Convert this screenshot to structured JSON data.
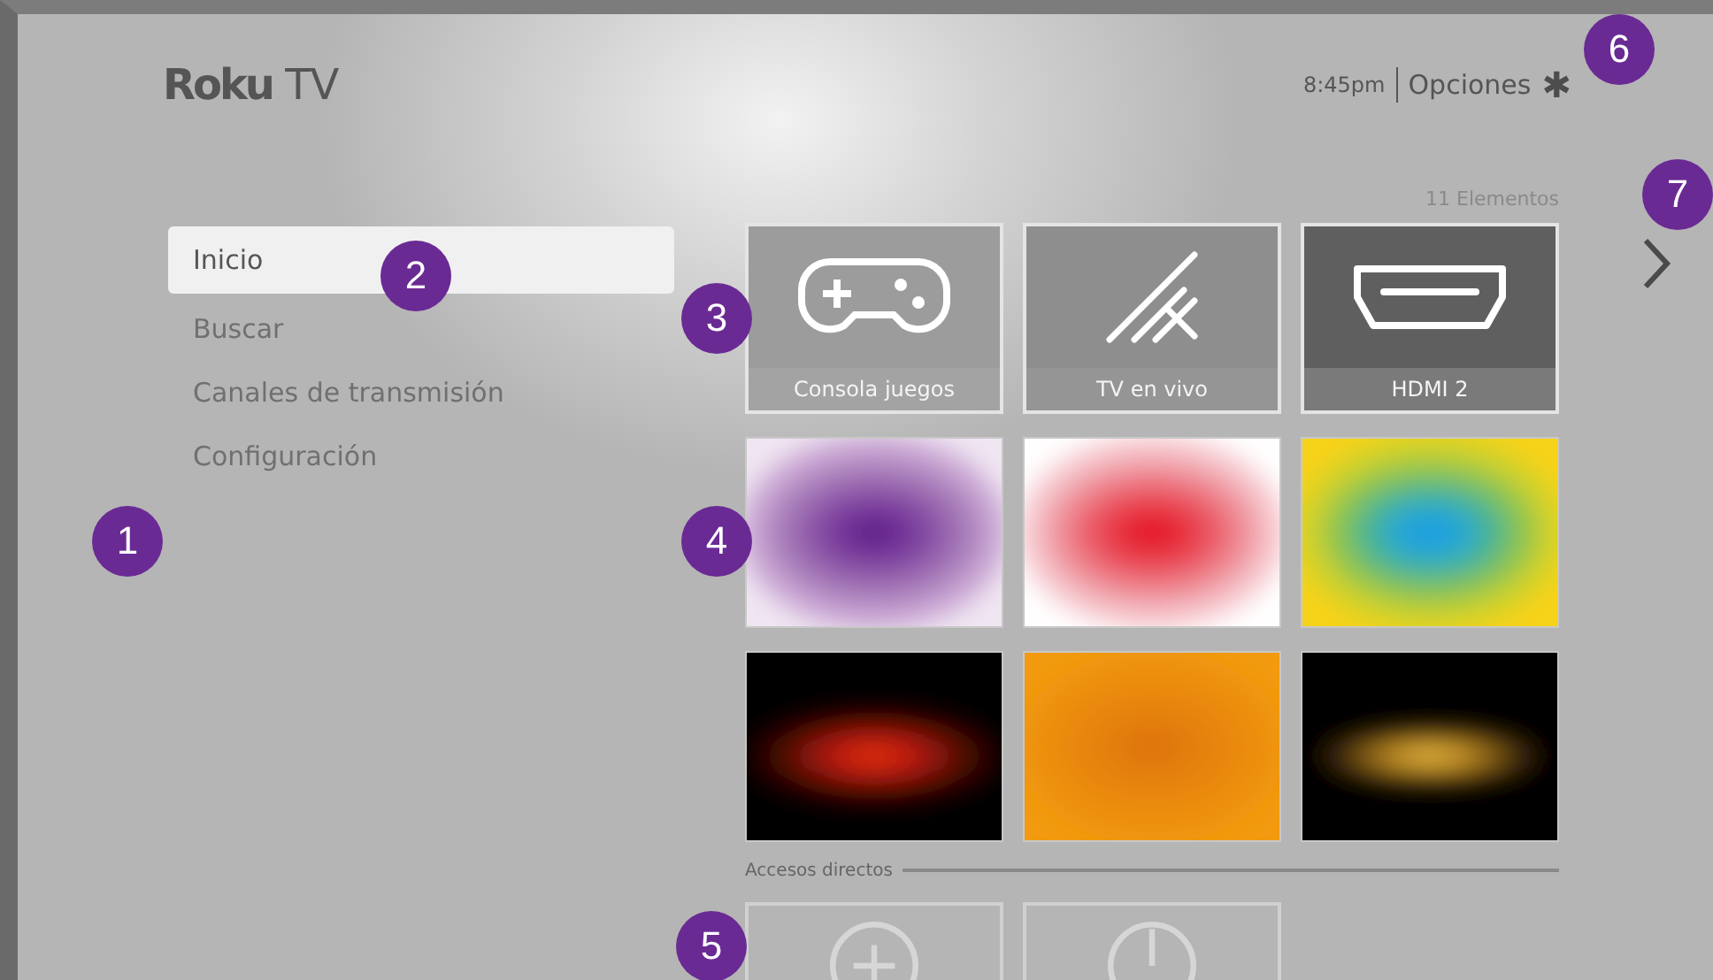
{
  "logo": "**Roku** TV",
  "header": {
    "time": "8:45pm",
    "options": "Opciones",
    "options_icon": "✱"
  },
  "menu": [
    {
      "label": "Inicio",
      "selected": true
    },
    {
      "label": "Buscar",
      "selected": false
    },
    {
      "label": "Canales de transmisión",
      "selected": false
    },
    {
      "label": "Configuración",
      "selected": false
    }
  ],
  "item_count": "11 Elementos",
  "tiles": [
    {
      "kind": "app",
      "label": "Consola juegos"
    },
    {
      "kind": "app",
      "label": "TV en vivo"
    },
    {
      "kind": "app",
      "label": "HDMI 2"
    },
    {
      "kind": "picture"
    },
    {
      "kind": "picture"
    },
    {
      "kind": "picture"
    },
    {
      "kind": "picture"
    },
    {
      "kind": "picture"
    },
    {
      "kind": "picture"
    }
  ],
  "shortcuts": {
    "title": "Accesos directos",
    "items": [
      {
        "kind": "add"
      },
      {
        "kind": "power"
      }
    ]
  },
  "callouts": [
    {
      "label": "1"
    },
    {
      "label": "2"
    },
    {
      "label": "3"
    },
    {
      "label": "4"
    },
    {
      "label": "5"
    },
    {
      "label": "6"
    },
    {
      "label": "7"
    }
  ]
}
